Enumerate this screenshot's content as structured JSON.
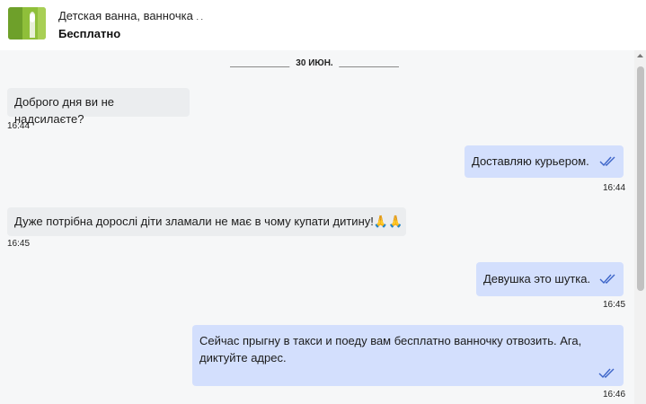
{
  "listing": {
    "title": "Детская ванна, ванночка",
    "title_trail": ". .",
    "price": "Бесплатно",
    "thumbnail_icon": "product-thumbnail-icon"
  },
  "chat": {
    "date_separator": "30 ИЮН.",
    "messages": [
      {
        "direction": "incoming",
        "text": "Доброго дня ви не надсилаєте?",
        "time": "16:44"
      },
      {
        "direction": "outgoing",
        "text": "Доставляю курьером.",
        "time": "16:44",
        "status_icon": "double-check-icon"
      },
      {
        "direction": "incoming",
        "text": "Дуже потрібна дорослі діти зламали не має в чому купати дитину!🙏🙏",
        "time": "16:45"
      },
      {
        "direction": "outgoing",
        "text": "Девушка это шутка.",
        "time": "16:45",
        "status_icon": "double-check-icon"
      },
      {
        "direction": "outgoing",
        "text": "Сейчас прыгну в такси и поеду вам бесплатно ванночку отвозить. Ага, диктуйте адрес.",
        "time": "16:46",
        "status_icon": "double-check-icon"
      }
    ]
  },
  "colors": {
    "incoming_bubble": "#ebedef",
    "outgoing_bubble": "#d3dffd",
    "chat_background": "#f6f7f8",
    "check_icon": "#3c64c8"
  }
}
